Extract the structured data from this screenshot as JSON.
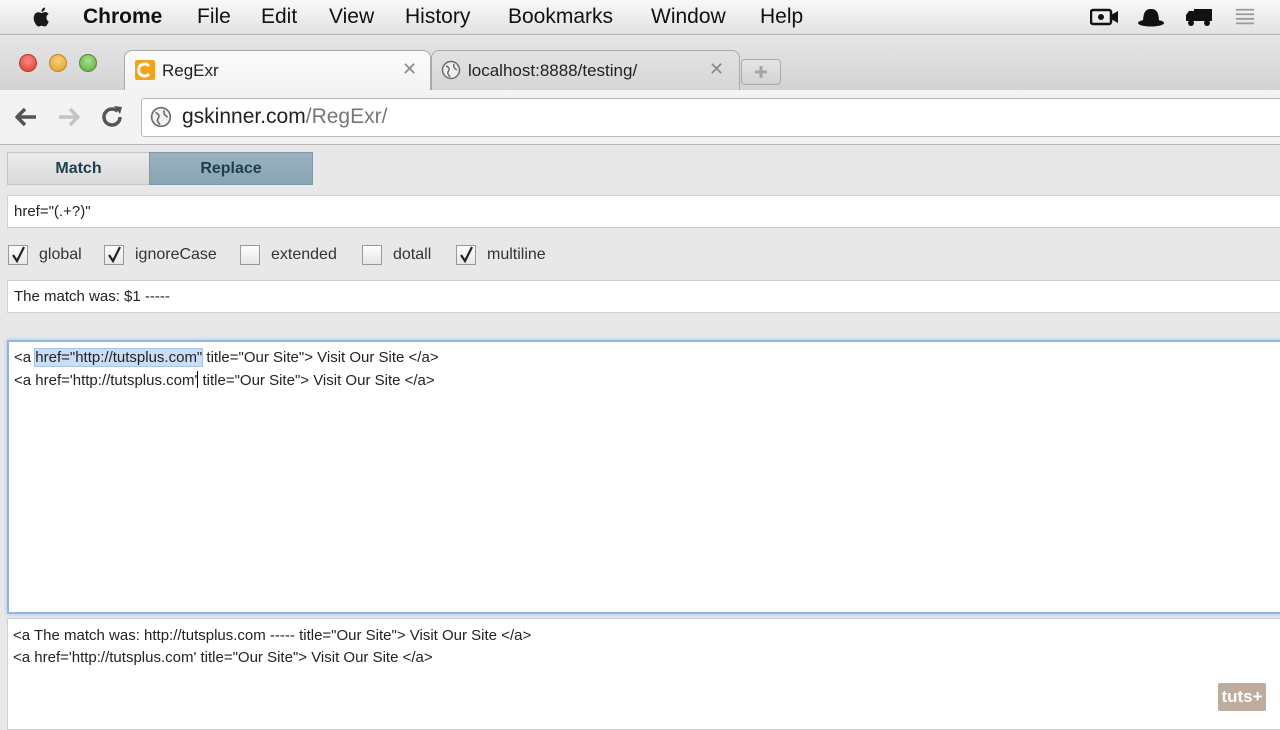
{
  "menubar": {
    "app": "Chrome",
    "items": [
      "File",
      "Edit",
      "View",
      "History",
      "Bookmarks",
      "Window",
      "Help"
    ],
    "tray_icons": [
      "video-camera-icon",
      "hat-icon",
      "truck-icon",
      "list-icon"
    ]
  },
  "tabs": [
    {
      "title": "RegExr",
      "favicon": "regexr-favicon-icon",
      "active": true
    },
    {
      "title": "localhost:8888/testing/",
      "favicon": "globe-icon",
      "active": false
    }
  ],
  "toolbar": {
    "url_host": "gskinner.com",
    "url_path": "/RegExr/"
  },
  "app": {
    "modes": [
      "Match",
      "Replace"
    ],
    "active_mode": "Replace",
    "pattern": "href=\"(.+?)\"",
    "flags": [
      {
        "label": "global",
        "checked": true
      },
      {
        "label": "ignoreCase",
        "checked": true
      },
      {
        "label": "extended",
        "checked": false
      },
      {
        "label": "dotall",
        "checked": false
      },
      {
        "label": "multiline",
        "checked": true
      }
    ],
    "replacement": "The match was: $1 -----",
    "source": {
      "line1_prefix": "<a ",
      "line1_match": "href=\"http://tutsplus.com\"",
      "line1_suffix": " title=\"Our Site\"> Visit Our Site </a>",
      "line2_before_caret": "<a href='http://tutsplus.com'",
      "line2_after_caret": " title=\"Our Site\"> Visit Our Site </a>"
    },
    "result": {
      "line1": "<a The match was: http://tutsplus.com ----- title=\"Our Site\"> Visit Our Site </a>",
      "line2": "<a href='http://tutsplus.com' title=\"Our Site\"> Visit Our Site </a>"
    }
  },
  "watermark": "tuts+",
  "colors": {
    "active_mode_tab": "#8fa9b8",
    "selection": "#c9ddf4",
    "focus_ring": "#8fb7e0"
  }
}
